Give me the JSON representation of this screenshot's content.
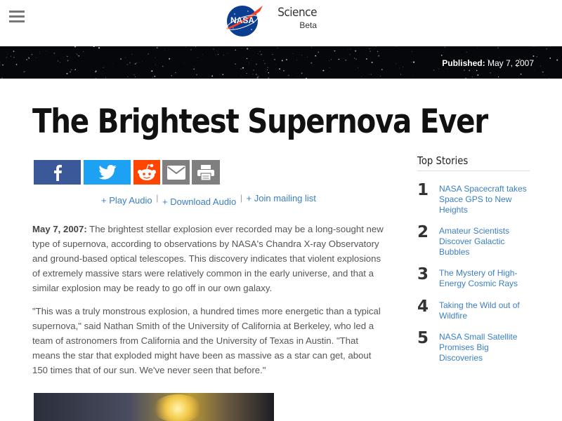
{
  "header": {
    "logo_text": "NASA",
    "brand_name": "Science",
    "brand_sub": "Beta"
  },
  "banner": {
    "published_label": "Published:",
    "published_date": "May 7, 2007"
  },
  "article": {
    "title": "The Brightest Supernova Ever",
    "audio_links": {
      "play": "+ Play Audio",
      "download": "+ Download Audio",
      "mailing": "+ Join mailing list",
      "separator": "|"
    },
    "dateline": "May 7, 2007:",
    "p1": "The brightest stellar explosion ever recorded may be a long-sought new type of supernova, according to observations by NASA's Chandra X-ray Observatory and ground-based optical telescopes. This discovery indicates that violent explosions of extremely massive stars were relatively common in the early universe, and that a similar explosion may be ready to go off in our own galaxy.",
    "p2": "\"This was a truly monstrous explosion, a hundred times more energetic than a typical supernova,\" said Nathan Smith of the University of California at Berkeley, who led a team of astronomers from California and the University of Texas in Austin. \"That means the star that exploded might have been as massive as a star can get, about 150 times that of our sun. We've never seen that before.\""
  },
  "share": {
    "icons": [
      "facebook-icon",
      "twitter-icon",
      "reddit-icon",
      "email-icon",
      "print-icon"
    ],
    "colors": {
      "facebook": "#3b5998",
      "twitter": "#1da1f2",
      "reddit": "#ff4500",
      "email": "#7f7f7f",
      "print": "#7f7f7f"
    }
  },
  "sidebar": {
    "title": "Top Stories",
    "stories": [
      {
        "num": "1",
        "label": "NASA Spacecraft takes Space GPS to New Heights"
      },
      {
        "num": "2",
        "label": "Amateur Scientists Discover Galactic Bubbles"
      },
      {
        "num": "3",
        "label": "The Mystery of High-Energy Cosmic Rays"
      },
      {
        "num": "4",
        "label": "Taking the Wild out of Wildfire"
      },
      {
        "num": "5",
        "label": "NASA Small Satellite Promises Big Discoveries"
      }
    ]
  },
  "colors": {
    "link": "#3b7fc4",
    "banner": "#06070b",
    "title": "#111111"
  }
}
